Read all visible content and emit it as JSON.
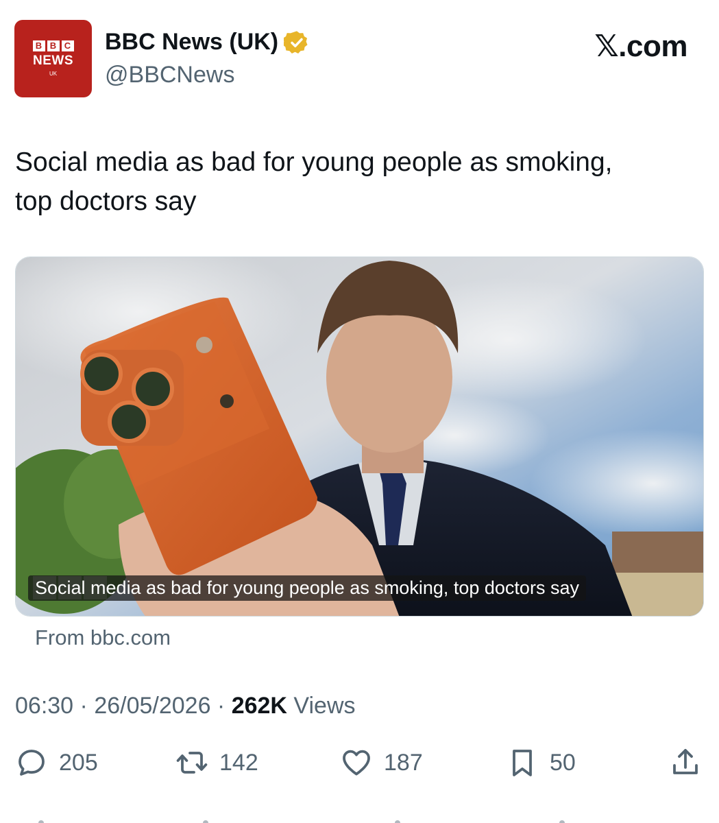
{
  "account": {
    "avatar_bbc": [
      "B",
      "B",
      "C"
    ],
    "avatar_news": "NEWS",
    "avatar_uk": "UK",
    "display_name": "BBC News (UK)",
    "handle": "@BBCNews",
    "verified_badge_color": "#e8b52a"
  },
  "header": {
    "site_label": "𝕏.com"
  },
  "tweet": {
    "text_line1": "Social media as bad for young people as smoking,",
    "text_line2": "top doctors say"
  },
  "media": {
    "caption": "Social media as bad for young people as smoking, top doctors say",
    "description_icon": "photo-of-teen-with-phone"
  },
  "link_source": "From bbc.com",
  "meta": {
    "time": "06:30",
    "separator": " · ",
    "date": "26/05/2026",
    "views_count": "262K",
    "views_label": " Views"
  },
  "actions": {
    "replies": "205",
    "reposts": "142",
    "likes": "187",
    "bookmarks": "50"
  },
  "colors": {
    "brand_red": "#b8221d",
    "muted_text": "#536471",
    "primary_text": "#0f1419"
  }
}
